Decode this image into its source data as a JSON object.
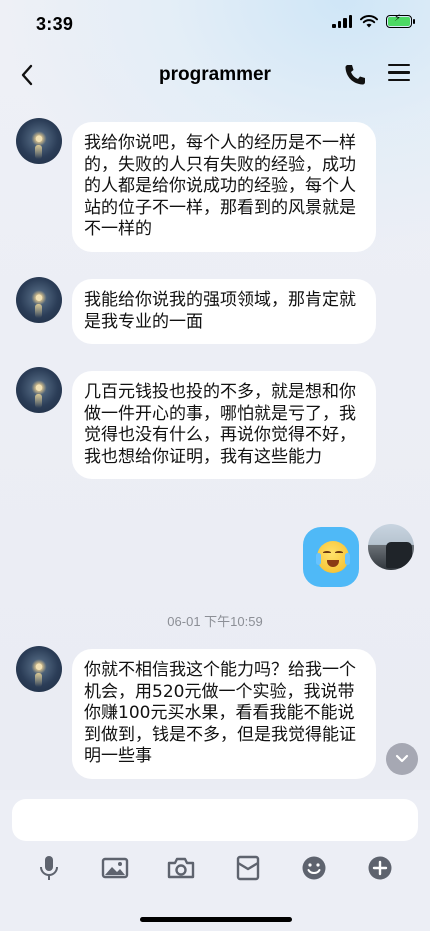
{
  "status_bar": {
    "time": "3:39"
  },
  "header": {
    "title": "programmer"
  },
  "messages": [
    {
      "side": "left",
      "text": "我给你说吧，每个人的经历是不一样的，失败的人只有失败的经验，成功的人都是给你说成功的经验，每个人站的位子不一样，那看到的风景就是不一样的"
    },
    {
      "side": "left",
      "text": "我能给你说我的强项领域，那肯定就是我专业的一面"
    },
    {
      "side": "left",
      "text": "几百元钱投也投的不多，就是想和你做一件开心的事，哪怕就是亏了，我觉得也没有什么，再说你觉得不好，我也想给你证明，我有这些能力"
    },
    {
      "side": "right",
      "emoji": "crying-laughing-emoji"
    },
    {
      "side": "left",
      "text": "你就不相信我这个能力吗？给我一个机会，用520元做一个实验，我说带你赚100元买水果，看看我能不能说到做到，钱是不多，但是我觉得能证明一些事"
    }
  ],
  "timestamp": "06-01 下午10:59",
  "colors": {
    "outgoing_bubble": "#4fb9f7",
    "incoming_bubble": "#ffffff",
    "background": "#eceef5"
  },
  "toolbar_icons": [
    "microphone-icon",
    "image-icon",
    "camera-icon",
    "red-packet-icon",
    "emoji-icon",
    "plus-icon"
  ]
}
